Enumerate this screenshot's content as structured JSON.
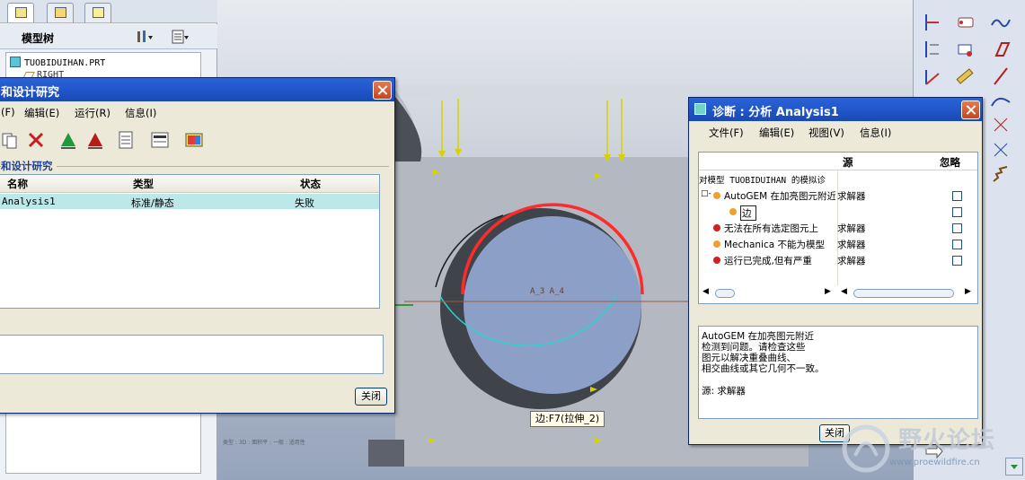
{
  "model_tree": {
    "title": "模型树",
    "items": [
      "TUOBIDUIHAN.PRT",
      "RIGHT"
    ]
  },
  "left_dialog": {
    "title": "和设计研究",
    "menus": [
      "(F)",
      "编辑(E)",
      "运行(R)",
      "信息(I)"
    ],
    "section_label": "和设计研究",
    "table": {
      "headers": [
        "名称",
        "类型",
        "状态"
      ],
      "rows": [
        [
          "Analysis1",
          "标准/静态",
          "失败"
        ]
      ]
    },
    "close_label": "关闭"
  },
  "right_dialog": {
    "title": "诊断 : 分析 Analysis1",
    "menus": [
      "文件(F)",
      "编辑(E)",
      "视图(V)",
      "信息(I)"
    ],
    "col_source": "源",
    "col_ignore": "忽略",
    "tree_header": "对模型 TUOBIDUIHAN 的模拟诊",
    "rows": [
      {
        "label": "AutoGEM 在加亮图元附近",
        "source": "求解器",
        "level": "warning"
      },
      {
        "label": "边",
        "source": "",
        "level": "warning"
      },
      {
        "label": "无法在所有选定图元上",
        "source": "求解器",
        "level": "error"
      },
      {
        "label": "Mechanica 不能为模型",
        "source": "求解器",
        "level": "warning"
      },
      {
        "label": "运行已完成,但有严重",
        "source": "求解器",
        "level": "error"
      }
    ],
    "detail_lines": [
      "AutoGEM 在加亮图元附近",
      "检测到问题。请检查这些",
      "图元以解决重叠曲线、",
      "相交曲线或其它几何不一致。"
    ],
    "detail_source": "源: 求解器",
    "close_label": "关闭"
  },
  "viewport": {
    "dim_label": "A_3  A_4",
    "status_text": "类型 : 3D : 面积平 : 一般 : 适用性",
    "edge_tooltip": "边:F7(拉伸_2)"
  },
  "watermark": {
    "title": "野火论坛",
    "url": "www.proewildfire.cn"
  },
  "colors": {
    "title_bar": "#1f54c6",
    "highlight_red": "#ff2a2a",
    "highlight_cyan": "#2bd3d3",
    "selected_row": "#bde8ea"
  }
}
